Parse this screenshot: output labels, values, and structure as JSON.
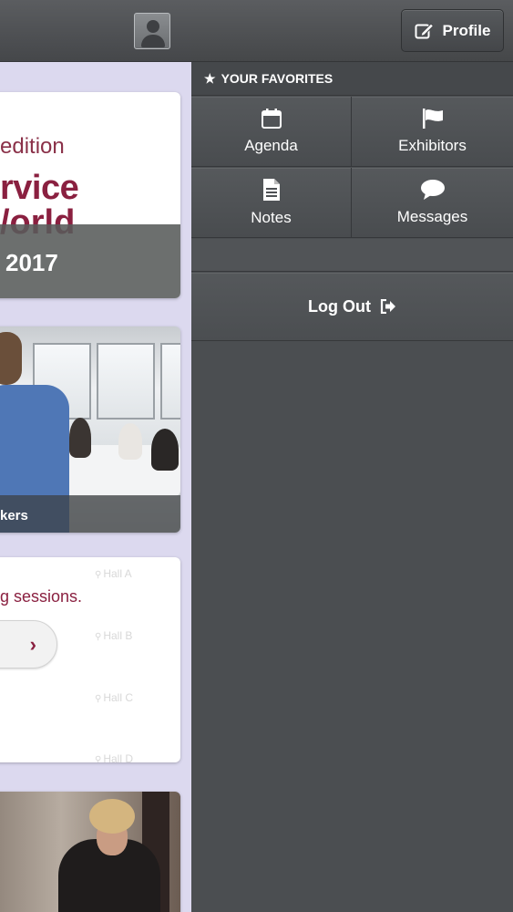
{
  "left_panel": {
    "card1": {
      "edition": "edition",
      "line1": "rvice",
      "line2": "/orld",
      "year": "2017"
    },
    "card2": {
      "label": "kers"
    },
    "card3": {
      "text": "g sessions.",
      "arrow": "›",
      "halls": [
        "Hall A",
        "Hall B",
        "Hall C",
        "Hall D"
      ]
    }
  },
  "menu": {
    "profile_label": "Profile",
    "favorites_header": "YOUR FAVORITES",
    "tiles": [
      {
        "label": "Agenda",
        "icon": "calendar-icon"
      },
      {
        "label": "Exhibitors",
        "icon": "flag-icon"
      },
      {
        "label": "Notes",
        "icon": "document-icon"
      },
      {
        "label": "Messages",
        "icon": "chat-bubble-icon"
      }
    ],
    "logout_label": "Log Out"
  },
  "colors": {
    "menu_bg": "#4b4e51",
    "accent": "#8a2040",
    "left_bg": "#dcd9ef"
  }
}
